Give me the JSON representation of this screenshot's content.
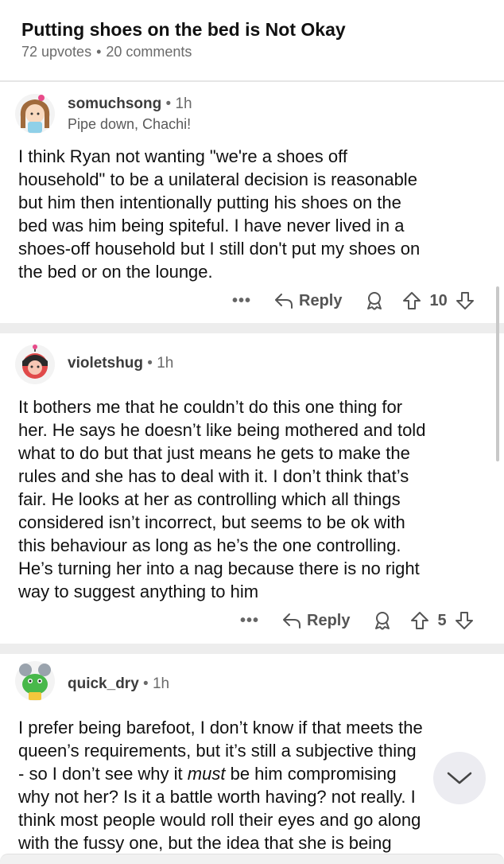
{
  "post": {
    "title": "Putting shoes on the bed is Not Okay",
    "upvotes": "72 upvotes",
    "comments": "20 comments"
  },
  "comments": [
    {
      "username": "somuchsong",
      "time": "1h",
      "flair": "Pipe down, Chachi!",
      "lines": [
        "I think Ryan not wanting \"we're a shoes off",
        "household\" to be a unilateral decision is reasonable",
        "but him then intentionally putting his shoes on the",
        "bed was him being spiteful. I have never lived in a",
        "shoes-off household but I still don't put my shoes on",
        "the bed or on the lounge."
      ],
      "reply_label": "Reply",
      "votes": "10"
    },
    {
      "username": "violetshug",
      "time": "1h",
      "lines": [
        "It bothers me that he couldn’t do this one thing for",
        "her. He says he doesn’t like being mothered and told",
        "what to do but that just means he gets to make the",
        "rules and she has to deal with it. I don’t think that’s",
        "fair. He looks at her as controlling which all things",
        "considered isn’t incorrect, but seems to be ok with",
        "this behaviour as long as he’s the one controlling.",
        "He’s turning her into a nag because there is no right",
        "way to suggest anything to him"
      ],
      "reply_label": "Reply",
      "votes": "5"
    },
    {
      "username": "quick_dry",
      "time": "1h",
      "lines": [
        "I prefer being barefoot, I don’t know if that meets the",
        "queen’s requirements, but it’s still a subjective thing",
        "- so I don’t see why it",
        "must",
        " be him compromising",
        "why not her? Is it a battle worth having? not really. I",
        "think most people would roll their eyes and go along",
        "with the fussy one, but the idea that she is being"
      ]
    }
  ],
  "colors": {
    "header_bg": "#ffffff",
    "separator": "#ededed",
    "text": "#111111",
    "meta": "#6b6b6b"
  }
}
